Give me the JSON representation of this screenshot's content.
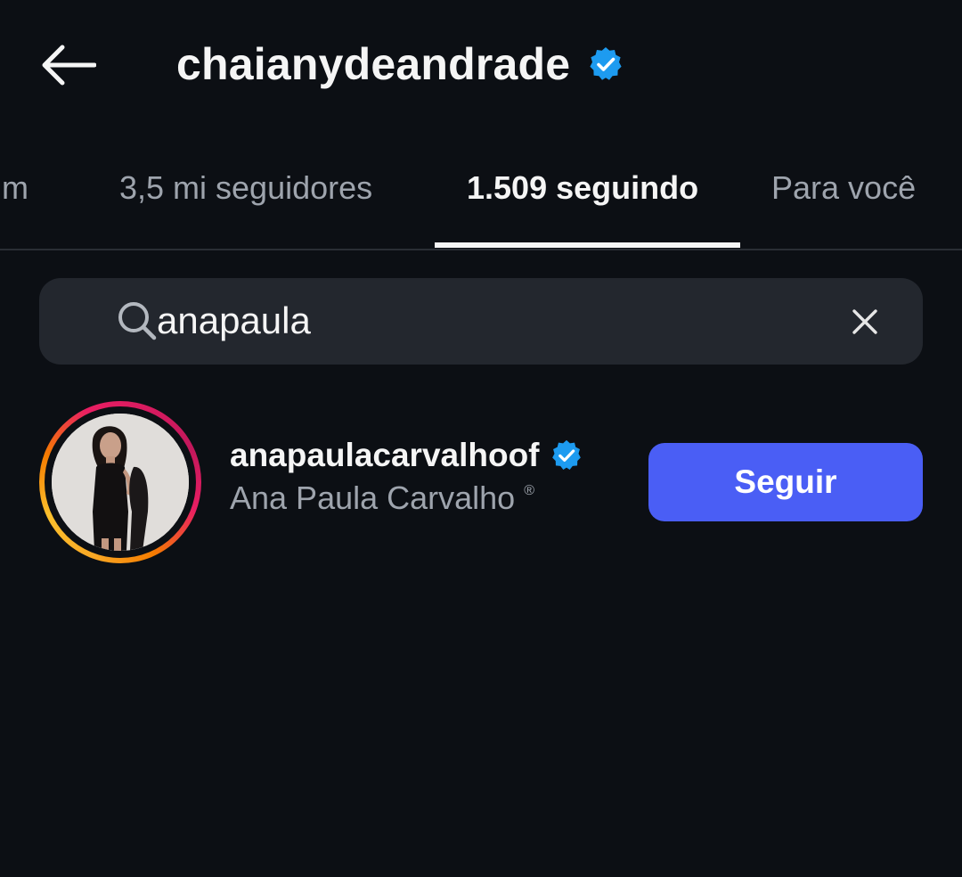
{
  "header": {
    "username": "chaianydeandrade",
    "verified_icon": "verified-badge-icon",
    "back_icon": "arrow-left-icon"
  },
  "tabs": [
    {
      "label": "um",
      "active": false
    },
    {
      "label": "3,5 mi seguidores",
      "active": false
    },
    {
      "label": "1.509 seguindo",
      "active": true
    },
    {
      "label": "Para você",
      "active": false
    }
  ],
  "search": {
    "value": "anapaula",
    "search_icon": "search-icon",
    "clear_icon": "close-icon"
  },
  "results": [
    {
      "username": "anapaulacarvalhoof",
      "full_name": "Ana Paula Carvalho",
      "registered_mark": "®",
      "verified": true,
      "button_label": "Seguir"
    }
  ],
  "colors": {
    "background": "#0c0f14",
    "search_bg": "#23272e",
    "primary_button": "#4a5ef5",
    "verified_blue": "#1d9bf0",
    "secondary_text": "#9ea4ad"
  }
}
